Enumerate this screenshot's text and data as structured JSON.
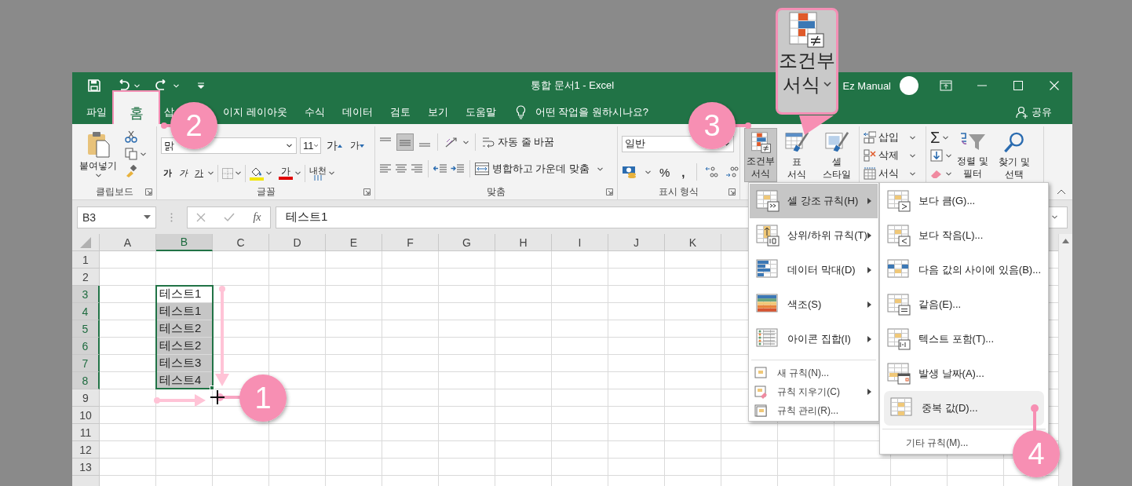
{
  "window": {
    "title": "통합 문서1  -  Excel",
    "account": "Ez Manual"
  },
  "tabs": [
    {
      "label": "파일",
      "selected": false,
      "framed": false
    },
    {
      "label": "홈",
      "selected": true,
      "framed": true
    },
    {
      "label": "삽",
      "selected": false,
      "framed": false
    },
    {
      "label": "이지 레이아웃",
      "selected": false,
      "framed": false
    },
    {
      "label": "수식",
      "selected": false,
      "framed": false
    },
    {
      "label": "데이터",
      "selected": false,
      "framed": false
    },
    {
      "label": "검토",
      "selected": false,
      "framed": false
    },
    {
      "label": "보기",
      "selected": false,
      "framed": false
    },
    {
      "label": "도움말",
      "selected": false,
      "framed": false
    }
  ],
  "tell_me": "어떤 작업을 원하시나요?",
  "share": "공유",
  "ribbon": {
    "clipboard": {
      "label": "클립보드",
      "paste": "붙여넣기"
    },
    "font": {
      "label": "글꼴",
      "font_name": "맑",
      "font_size": "11",
      "grow": "가",
      "shrink": "가",
      "bold": "가",
      "italic": "가",
      "underline": "가",
      "font_color": "가",
      "phonetic": "내천"
    },
    "alignment": {
      "label": "맞춤",
      "wrap_text": "자동 줄 바꿈",
      "merge": "병합하고 가운데 맞춤"
    },
    "number": {
      "label": "표시 형식",
      "format": "일반",
      "percent": "%",
      "comma": ","
    },
    "styles": {
      "conditional": {
        "lines": [
          "조건부",
          "서식"
        ],
        "pressed": true
      },
      "table": [
        "표",
        "서식"
      ],
      "cell": [
        "셀",
        "스타일"
      ]
    },
    "cells": [
      "삽입",
      "삭제",
      "서식"
    ],
    "editing": {
      "sum": "Σ",
      "sort": [
        "정렬 및",
        "필터"
      ],
      "find": [
        "찾기 및",
        "선택"
      ]
    }
  },
  "formula_bar": {
    "name_box": "B3",
    "fx": "fx",
    "value": "테스트1"
  },
  "sheet": {
    "columns": [
      {
        "label": "A",
        "selected": false
      },
      {
        "label": "B",
        "selected": true
      },
      {
        "label": "C",
        "selected": false
      },
      {
        "label": "D",
        "selected": false
      },
      {
        "label": "E",
        "selected": false
      },
      {
        "label": "F",
        "selected": false
      },
      {
        "label": "G",
        "selected": false
      },
      {
        "label": "H",
        "selected": false
      },
      {
        "label": "I",
        "selected": false
      },
      {
        "label": "J",
        "selected": false
      },
      {
        "label": "K",
        "selected": false
      }
    ],
    "rows": [
      {
        "label": "1",
        "selected": false
      },
      {
        "label": "2",
        "selected": false
      },
      {
        "label": "3",
        "selected": true
      },
      {
        "label": "4",
        "selected": true
      },
      {
        "label": "5",
        "selected": true
      },
      {
        "label": "6",
        "selected": true
      },
      {
        "label": "7",
        "selected": true
      },
      {
        "label": "8",
        "selected": true
      },
      {
        "label": "9",
        "selected": false
      },
      {
        "label": "10",
        "selected": false
      },
      {
        "label": "11",
        "selected": false
      },
      {
        "label": "12",
        "selected": false
      },
      {
        "label": "13",
        "selected": false
      }
    ],
    "cells": [
      {
        "text": "테스트1",
        "active": true
      },
      {
        "text": "테스트1",
        "active": false
      },
      {
        "text": "테스트2",
        "active": false
      },
      {
        "text": "테스트2",
        "active": false
      },
      {
        "text": "테스트3",
        "active": false
      },
      {
        "text": "테스트4",
        "active": false
      }
    ]
  },
  "menu": [
    {
      "label": "셀 강조 규칙(H)",
      "kind": "large",
      "selected": true,
      "submenu": true
    },
    {
      "label": "상위/하위 규칙(T)",
      "kind": "large",
      "selected": false,
      "submenu": true
    },
    {
      "label": "데이터 막대(D)",
      "kind": "large",
      "selected": false,
      "submenu": true
    },
    {
      "label": "색조(S)",
      "kind": "large",
      "selected": false,
      "submenu": true
    },
    {
      "label": "아이콘 집합(I)",
      "kind": "large",
      "selected": false,
      "submenu": true
    },
    {
      "label": "새 규칙(N)...",
      "kind": "small",
      "selected": false,
      "submenu": false
    },
    {
      "label": "규칙 지우기(C)",
      "kind": "small",
      "selected": false,
      "submenu": true
    },
    {
      "label": "규칙 관리(R)...",
      "kind": "small",
      "selected": false,
      "submenu": false
    }
  ],
  "submenu": [
    {
      "label": "보다 큼(G)...",
      "kind": "large",
      "selected": false
    },
    {
      "label": "보다 작음(L)...",
      "kind": "large",
      "selected": false
    },
    {
      "label": "다음 값의 사이에 있음(B)...",
      "kind": "large",
      "selected": false
    },
    {
      "label": "같음(E)...",
      "kind": "large",
      "selected": false
    },
    {
      "label": "텍스트 포함(T)...",
      "kind": "large",
      "selected": false
    },
    {
      "label": "발생 날짜(A)...",
      "kind": "large",
      "selected": false
    },
    {
      "label": "중복 값(D)...",
      "kind": "large",
      "selected": true
    },
    {
      "label": "기타 규칙(M)...",
      "kind": "plain",
      "selected": false
    }
  ],
  "callout": {
    "lines": [
      "조건부",
      "서식"
    ]
  },
  "steps": [
    "1",
    "2",
    "3",
    "4"
  ]
}
